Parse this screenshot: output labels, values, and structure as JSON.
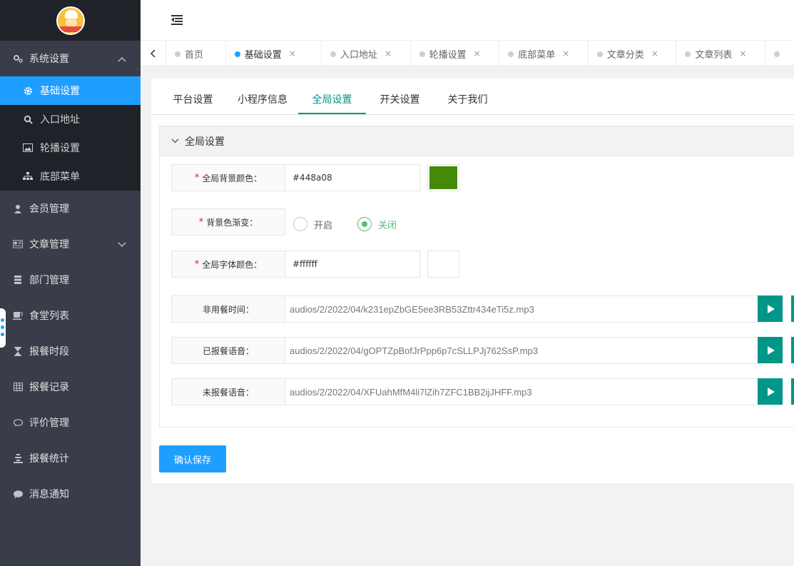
{
  "sidebar": {
    "groups": [
      {
        "label": "系统设置",
        "icon": "gears-icon",
        "expanded": true,
        "arrow": "^",
        "children": [
          {
            "label": "基础设置",
            "icon": "gear-icon",
            "active": true
          },
          {
            "label": "入口地址",
            "icon": "search-icon"
          },
          {
            "label": "轮播设置",
            "icon": "image-icon"
          },
          {
            "label": "底部菜单",
            "icon": "sitemap-icon"
          }
        ]
      },
      {
        "label": "会员管理",
        "icon": "user-icon"
      },
      {
        "label": "文章管理",
        "icon": "newspaper-icon",
        "arrow": "v"
      },
      {
        "label": "部门管理",
        "icon": "building-icon"
      },
      {
        "label": "食堂列表",
        "icon": "cup-icon"
      },
      {
        "label": "报餐时段",
        "icon": "hourglass-icon"
      },
      {
        "label": "报餐记录",
        "icon": "table-icon"
      },
      {
        "label": "评价管理",
        "icon": "comments-icon"
      },
      {
        "label": "报餐统计",
        "icon": "chart-icon"
      },
      {
        "label": "消息通知",
        "icon": "message-icon"
      }
    ]
  },
  "tabs": [
    {
      "label": "首页",
      "closable": false,
      "active": false
    },
    {
      "label": "基础设置",
      "closable": true,
      "active": true
    },
    {
      "label": "入口地址",
      "closable": true,
      "active": false
    },
    {
      "label": "轮播设置",
      "closable": true,
      "active": false
    },
    {
      "label": "底部菜单",
      "closable": true,
      "active": false
    },
    {
      "label": "文章分类",
      "closable": true,
      "active": false
    },
    {
      "label": "文章列表",
      "closable": true,
      "active": false
    }
  ],
  "tab_close_glyph": "×",
  "subtabs": [
    "平台设置",
    "小程序信息",
    "全局设置",
    "开关设置",
    "关于我们"
  ],
  "active_subtab": "全局设置",
  "panel": {
    "title": "全局设置",
    "bg_color": {
      "label": "全局背景颜色：",
      "value": "#448a08",
      "swatch": "#448a08"
    },
    "gradient": {
      "label": "背景色渐变：",
      "options": [
        "开启",
        "关闭"
      ],
      "selected": "关闭"
    },
    "font_color": {
      "label": "全局字体颜色：",
      "value": "#ffffff",
      "swatch": "#ffffff"
    },
    "audios": [
      {
        "label": "非用餐时间：",
        "value": "audios/2/2022/04/k231epZbGE5ee3RB53Zttr434eTi5z.mp3"
      },
      {
        "label": "已报餐语音：",
        "value": "audios/2/2022/04/gOPTZpBofJrPpp6p7cSLLPJj762SsP.mp3"
      },
      {
        "label": "未报餐语音：",
        "value": "audios/2/2022/04/XFUahMfM4li7lZih7ZFC1BB2ijJHFF.mp3"
      }
    ]
  },
  "save_label": "确认保存",
  "colors": {
    "primary": "#1e9fff",
    "teal": "#009688",
    "sidebar": "#393d49",
    "checked": "#5fb878"
  }
}
